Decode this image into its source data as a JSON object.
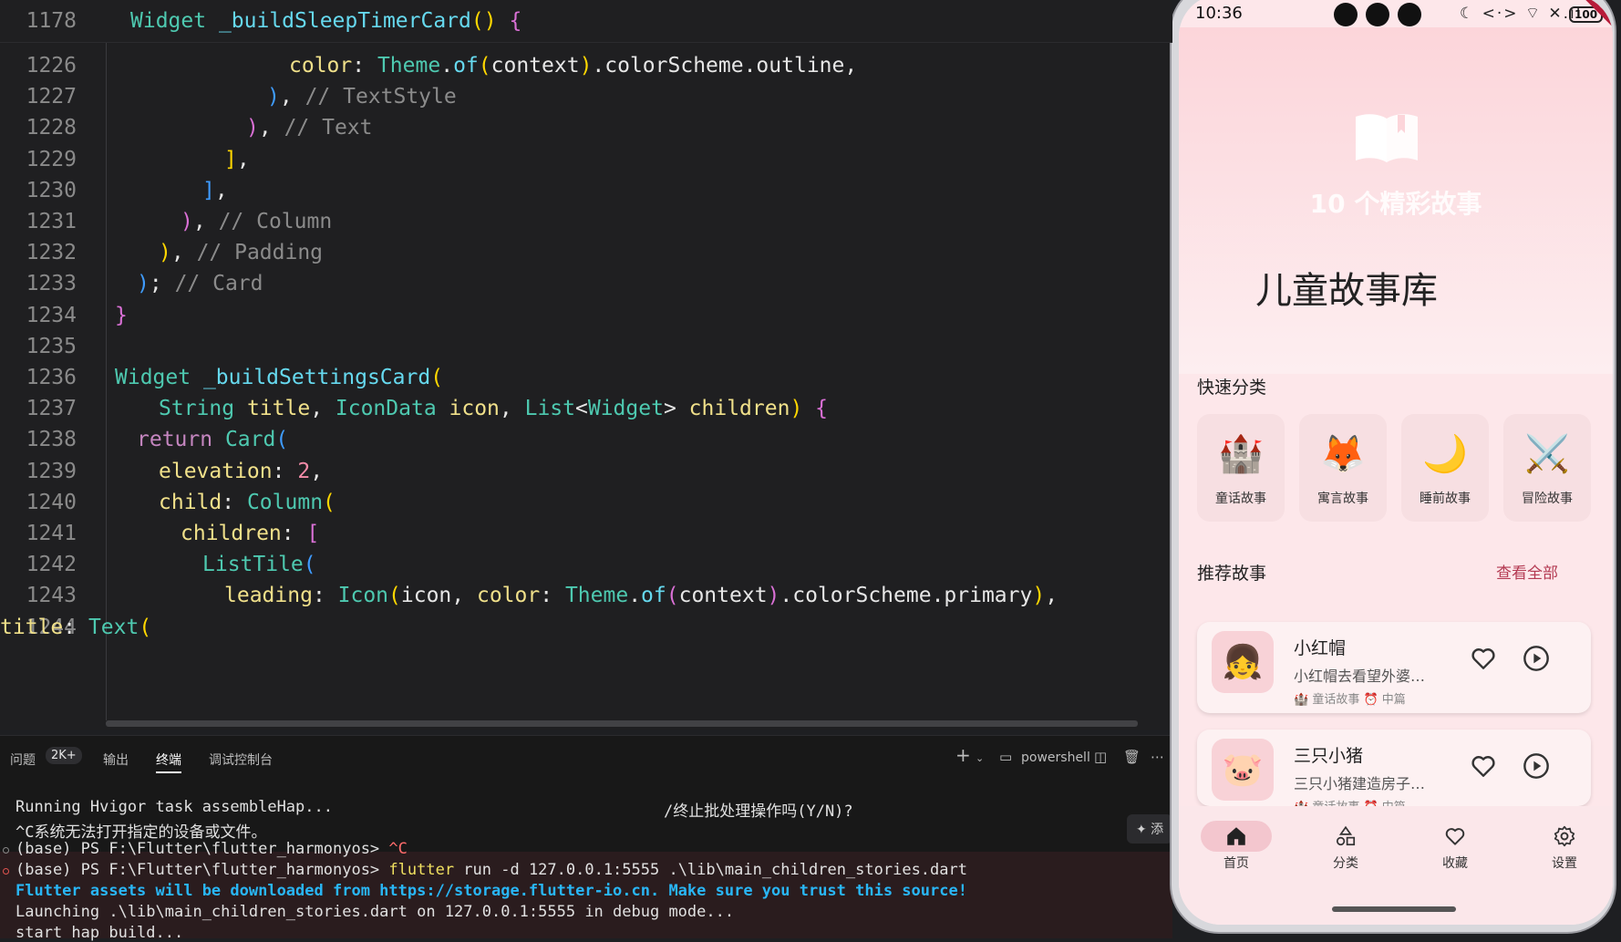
{
  "editor": {
    "sticky": {
      "num": "1178",
      "code": [
        {
          "t": "Widget ",
          "c": "ty"
        },
        {
          "t": "_buildSleepTimerCard",
          "c": "fn"
        },
        {
          "t": "()",
          "c": "b1"
        },
        {
          "t": " ",
          "c": "pl"
        },
        {
          "t": "{",
          "c": "b2"
        }
      ]
    },
    "lines": [
      {
        "num": "1226",
        "code": [
          {
            "t": "color",
            "c": "id"
          },
          {
            "t": ": ",
            "c": "pl"
          },
          {
            "t": "Theme",
            "c": "ty"
          },
          {
            "t": ".",
            "c": "pl"
          },
          {
            "t": "of",
            "c": "fn"
          },
          {
            "t": "(",
            "c": "b1"
          },
          {
            "t": "context",
            "c": "pl"
          },
          {
            "t": ")",
            "c": "b1"
          },
          {
            "t": ".colorScheme.outline,",
            "c": "pl"
          }
        ]
      },
      {
        "num": "1227",
        "code": [
          {
            "t": ")",
            "c": "b3"
          },
          {
            "t": ", ",
            "c": "pl"
          },
          {
            "t": "// TextStyle",
            "c": "cm"
          }
        ]
      },
      {
        "num": "1228",
        "code": [
          {
            "t": ")",
            "c": "b2"
          },
          {
            "t": ", ",
            "c": "pl"
          },
          {
            "t": "// Text",
            "c": "cm"
          }
        ]
      },
      {
        "num": "1229",
        "code": [
          {
            "t": "]",
            "c": "b1"
          },
          {
            "t": ",",
            "c": "pl"
          }
        ]
      },
      {
        "num": "1230",
        "code": [
          {
            "t": "]",
            "c": "b3"
          },
          {
            "t": ",",
            "c": "pl"
          }
        ]
      },
      {
        "num": "1231",
        "code": [
          {
            "t": ")",
            "c": "b2"
          },
          {
            "t": ", ",
            "c": "pl"
          },
          {
            "t": "// Column",
            "c": "cm"
          }
        ]
      },
      {
        "num": "1232",
        "code": [
          {
            "t": ")",
            "c": "b1"
          },
          {
            "t": ", ",
            "c": "pl"
          },
          {
            "t": "// Padding",
            "c": "cm"
          }
        ]
      },
      {
        "num": "1233",
        "code": [
          {
            "t": ")",
            "c": "b3"
          },
          {
            "t": "; ",
            "c": "pl"
          },
          {
            "t": "// Card",
            "c": "cm"
          }
        ]
      },
      {
        "num": "1234",
        "code": [
          {
            "t": "}",
            "c": "b2"
          }
        ]
      },
      {
        "num": "1235",
        "code": []
      },
      {
        "num": "1236",
        "code": [
          {
            "t": "Widget ",
            "c": "ty"
          },
          {
            "t": "_buildSettingsCard",
            "c": "fn"
          },
          {
            "t": "(",
            "c": "b1"
          }
        ]
      },
      {
        "num": "1237",
        "code": [
          {
            "t": "String ",
            "c": "ty"
          },
          {
            "t": "title",
            "c": "id"
          },
          {
            "t": ", ",
            "c": "pl"
          },
          {
            "t": "IconData ",
            "c": "ty"
          },
          {
            "t": "icon",
            "c": "id"
          },
          {
            "t": ", ",
            "c": "pl"
          },
          {
            "t": "List",
            "c": "ty"
          },
          {
            "t": "<",
            "c": "pl"
          },
          {
            "t": "Widget",
            "c": "ty"
          },
          {
            "t": "> ",
            "c": "pl"
          },
          {
            "t": "children",
            "c": "id"
          },
          {
            "t": ")",
            "c": "b1"
          },
          {
            "t": " ",
            "c": "pl"
          },
          {
            "t": "{",
            "c": "b2"
          }
        ]
      },
      {
        "num": "1238",
        "code": [
          {
            "t": "return ",
            "c": "ret"
          },
          {
            "t": "Card",
            "c": "ty"
          },
          {
            "t": "(",
            "c": "b3"
          }
        ]
      },
      {
        "num": "1239",
        "code": [
          {
            "t": "elevation",
            "c": "id"
          },
          {
            "t": ": ",
            "c": "pl"
          },
          {
            "t": "2",
            "c": "nm"
          },
          {
            "t": ",",
            "c": "pl"
          }
        ]
      },
      {
        "num": "1240",
        "code": [
          {
            "t": "child",
            "c": "id"
          },
          {
            "t": ": ",
            "c": "pl"
          },
          {
            "t": "Column",
            "c": "ty"
          },
          {
            "t": "(",
            "c": "b1"
          }
        ]
      },
      {
        "num": "1241",
        "code": [
          {
            "t": "children",
            "c": "id"
          },
          {
            "t": ": ",
            "c": "pl"
          },
          {
            "t": "[",
            "c": "b2"
          }
        ]
      },
      {
        "num": "1242",
        "code": [
          {
            "t": "ListTile",
            "c": "ty"
          },
          {
            "t": "(",
            "c": "b3"
          }
        ]
      },
      {
        "num": "1243",
        "code": [
          {
            "t": "leading",
            "c": "id"
          },
          {
            "t": ": ",
            "c": "pl"
          },
          {
            "t": "Icon",
            "c": "ty"
          },
          {
            "t": "(",
            "c": "b1"
          },
          {
            "t": "icon",
            "c": "pl"
          },
          {
            "t": ", ",
            "c": "pl"
          },
          {
            "t": "color",
            "c": "id"
          },
          {
            "t": ": ",
            "c": "pl"
          },
          {
            "t": "Theme",
            "c": "ty"
          },
          {
            "t": ".",
            "c": "pl"
          },
          {
            "t": "of",
            "c": "fn"
          },
          {
            "t": "(",
            "c": "b2"
          },
          {
            "t": "context",
            "c": "pl"
          },
          {
            "t": ")",
            "c": "b2"
          },
          {
            "t": ".colorScheme.primary",
            "c": "pl"
          },
          {
            "t": ")",
            "c": "b1"
          },
          {
            "t": ",",
            "c": "pl"
          }
        ]
      },
      {
        "num": "1244",
        "code": [
          {
            "t": "title",
            "c": "id"
          },
          {
            "t": ": ",
            "c": "pl"
          },
          {
            "t": "Text",
            "c": "ty"
          },
          {
            "t": "(",
            "c": "b1"
          }
        ]
      }
    ]
  },
  "panel": {
    "tabs": {
      "problems": "问题",
      "problems_count": "2K+",
      "output": "输出",
      "terminal": "终端",
      "debug_console": "调试控制台"
    },
    "tools": {
      "add": "+",
      "shell": "powershell"
    },
    "terminal": {
      "l1": "Running Hvigor task assembleHap...",
      "l1b": "/终止批处理操作吗(Y/N)?",
      "l2": "^C系统无法打开指定的设备或文件。",
      "l3_prompt": "(base) PS F:\\Flutter\\flutter_harmonyos> ",
      "l3_cmd": "^C",
      "l4_prompt": "(base) PS F:\\Flutter\\flutter_harmonyos> ",
      "l4_cmd": "flutter",
      "l4_rest": " run -d 127.0.0.1:5555 .\\lib\\main_children_stories.dart",
      "l5": "Flutter assets will be downloaded from https://storage.flutter-io.cn. Make sure you trust this source!",
      "l6": "Launching .\\lib\\main_children_stories.dart on 127.0.0.1:5555 in debug mode...",
      "l7": "start hap build...",
      "add_chip": "✦ 添"
    }
  },
  "phone": {
    "status": {
      "time": "10:36",
      "icons": "☾ <·> ⌔ ✕.ıl",
      "battery": "100",
      "debug_banner": "DEBUG"
    },
    "hero": {
      "subtitle": "10 个精彩故事",
      "title": "儿童故事库"
    },
    "quick_title": "快速分类",
    "categories": [
      {
        "emoji": "🏰",
        "label": "童话故事"
      },
      {
        "emoji": "🦊",
        "label": "寓言故事"
      },
      {
        "emoji": "🌙",
        "label": "睡前故事"
      },
      {
        "emoji": "⚔️",
        "label": "冒险故事"
      }
    ],
    "recommend_title": "推荐故事",
    "see_all": "查看全部",
    "stories": [
      {
        "emoji": "👧",
        "title": "小红帽",
        "desc": "小红帽去看望外婆…",
        "meta": "🏰 童话故事  ⏰ 中篇"
      },
      {
        "emoji": "🐷",
        "title": "三只小猪",
        "desc": "三只小猪建造房子…",
        "meta": "🏰 童话故事  ⏰ 中篇"
      }
    ],
    "nav": [
      {
        "label": "首页"
      },
      {
        "label": "分类"
      },
      {
        "label": "收藏"
      },
      {
        "label": "设置"
      }
    ],
    "colors": {
      "accent": "#b43a52",
      "hero_top": "#fcd5da",
      "card": "#f7dfe2"
    }
  }
}
